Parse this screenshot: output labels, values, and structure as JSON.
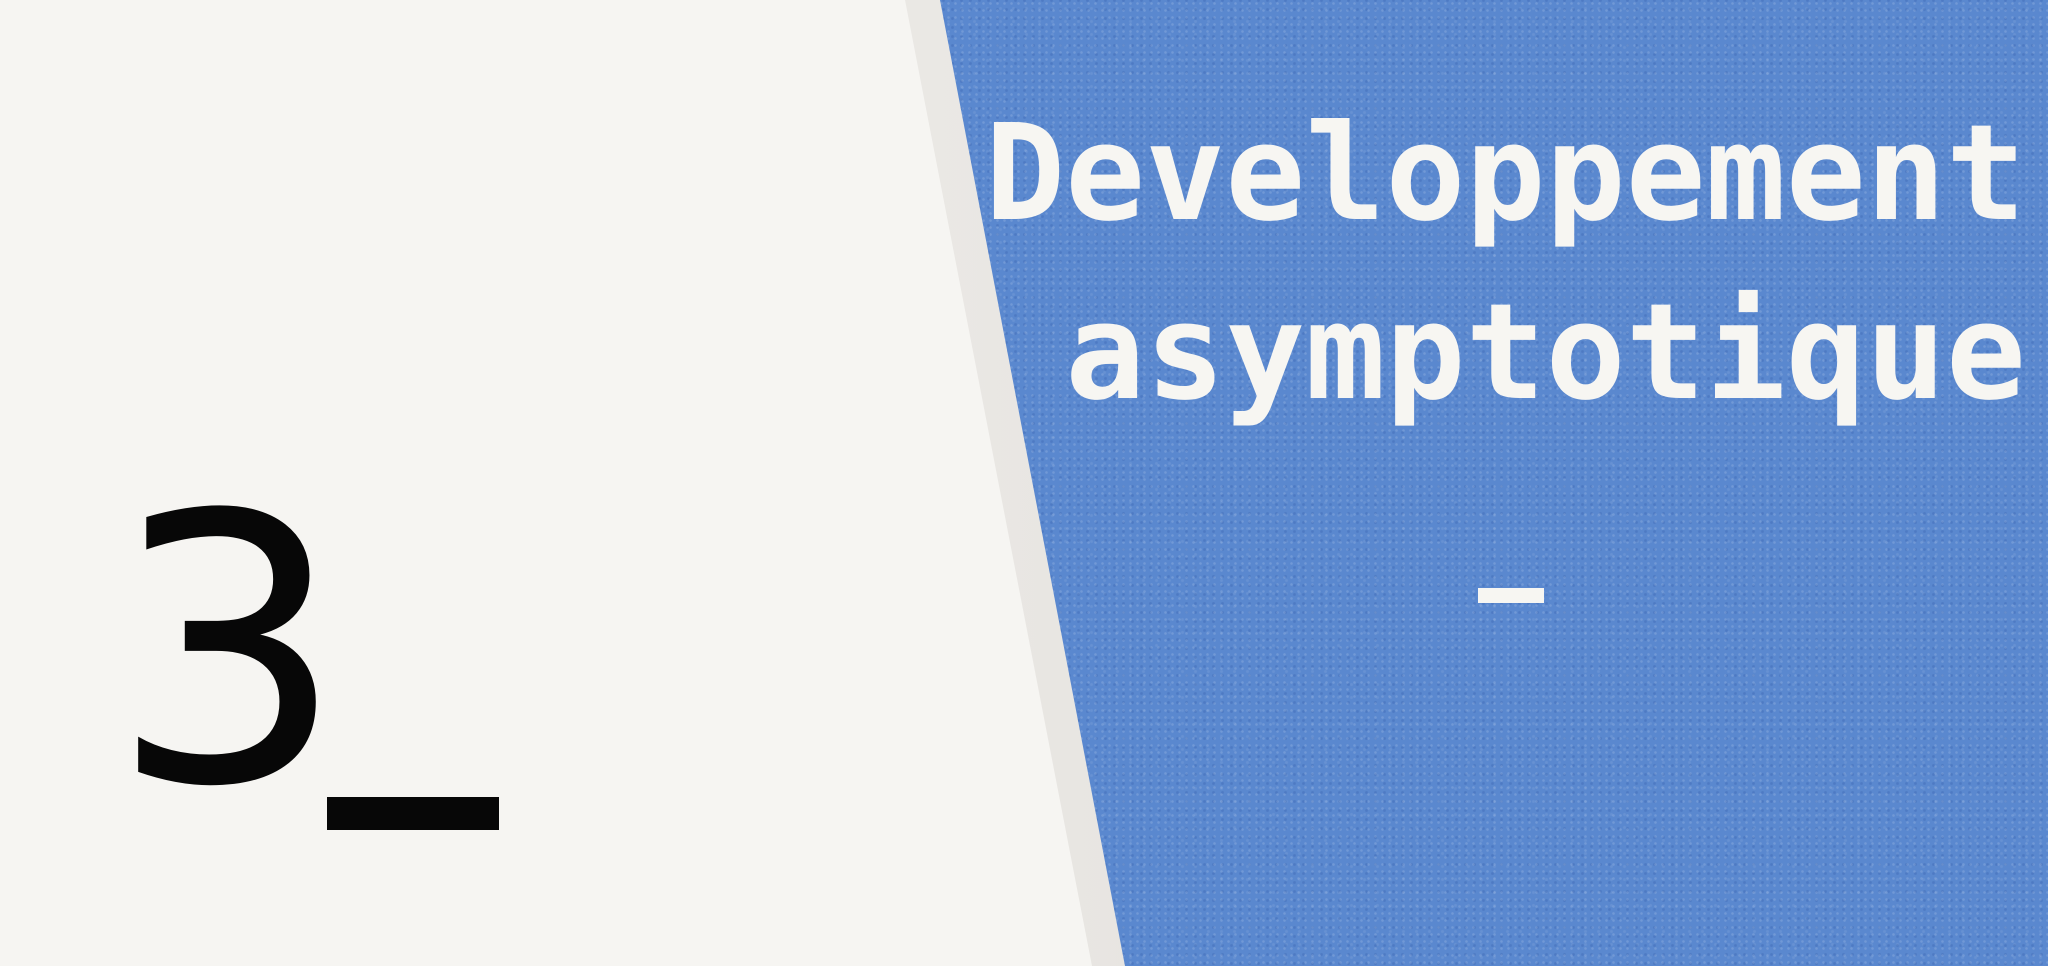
{
  "chapter": {
    "number": "3",
    "underscore": "_"
  },
  "title": {
    "line1": "Developpement",
    "line2": "asymptotique",
    "separator": "-"
  },
  "colors": {
    "background": "#f6f5f2",
    "panel": "#5a88cf",
    "text_dark": "#070707",
    "text_light": "#f7f6f2"
  }
}
